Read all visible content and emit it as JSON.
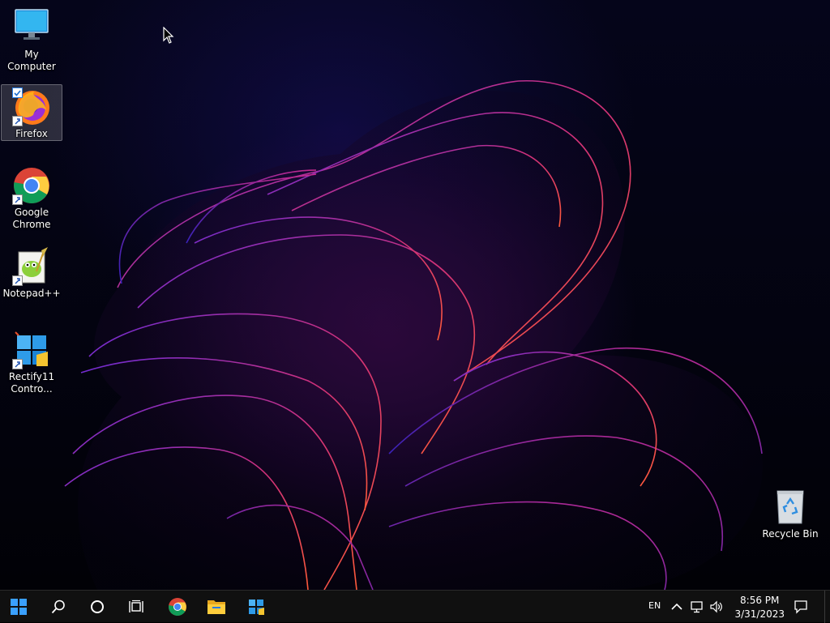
{
  "desktop": {
    "icons": [
      {
        "label": "My Computer"
      },
      {
        "label": "Firefox"
      },
      {
        "label": "Google\nChrome"
      },
      {
        "label": "Notepad++"
      },
      {
        "label": "Rectify11\nContro..."
      },
      {
        "label": "Recycle Bin"
      }
    ]
  },
  "taskbar": {
    "language": "EN",
    "time": "8:56 PM",
    "date": "3/31/2023",
    "pinned": [
      "start-icon",
      "search-icon",
      "cortana-icon",
      "task-view-icon",
      "chrome-icon",
      "file-explorer-icon",
      "rectify11-icon"
    ]
  },
  "colors": {
    "taskbar_bg": "#101010",
    "accent": "#1e90ff",
    "wallpaper_glow": "#c0267e"
  }
}
